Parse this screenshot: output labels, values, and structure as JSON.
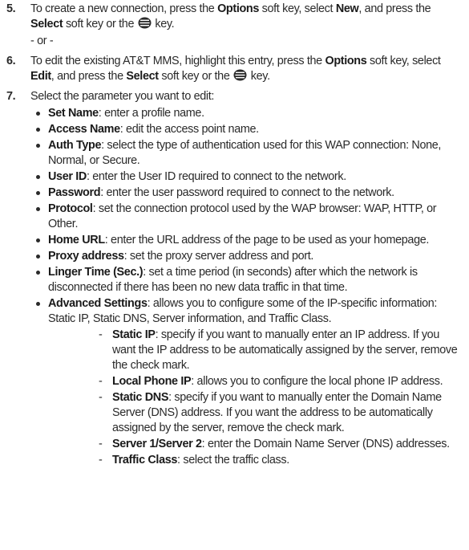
{
  "step5": {
    "number": "5.",
    "t1": "To create a new connection, press the ",
    "b1": "Options",
    "t2": " soft key, select ",
    "b2": "New",
    "t3": ", and press the ",
    "b3": "Select",
    "t4": " soft key or the ",
    "t5": " key."
  },
  "or_text": "- or -",
  "step6": {
    "number": "6.",
    "t1": "To edit the existing AT&T MMS, highlight this entry, press the ",
    "b1": "Options",
    "t2": " soft key, select ",
    "b2": "Edit",
    "t3": ", and press the ",
    "b3": "Select",
    "t4": " soft key or the ",
    "t5": " key."
  },
  "step7": {
    "number": "7.",
    "text": "Select the parameter you want to edit:"
  },
  "params": [
    {
      "name": "Set Name",
      "desc": ": enter a profile name."
    },
    {
      "name": "Access Name",
      "desc": ": edit the access point name."
    },
    {
      "name": "Auth Type",
      "desc": ": select the type of authentication used for this WAP connection: None, Normal, or Secure."
    },
    {
      "name": "User ID",
      "desc": ": enter the User ID required to connect to the network."
    },
    {
      "name": "Password",
      "desc": ": enter the user password required to connect to the network."
    },
    {
      "name": "Protocol",
      "desc": ": set the connection protocol used by the WAP browser: WAP, HTTP, or Other."
    },
    {
      "name": "Home URL",
      "desc": ": enter the URL address of the page to be used as your homepage."
    },
    {
      "name": "Proxy address",
      "desc": ": set the proxy server address and port."
    },
    {
      "name": "Linger Time (Sec.)",
      "desc": ": set a time period (in seconds) after which the network is disconnected if there has been no new data traffic in that time."
    },
    {
      "name": "Advanced Settings",
      "desc": ": allows you to configure some of the IP-specific information: Static IP, Static DNS, Server information, and Traffic Class."
    }
  ],
  "sub_params": [
    {
      "dash": "-",
      "name": "Static IP",
      "desc": ": specify if you want to manually enter an IP address. If you want the IP address to be automatically assigned by the server, remove the check mark."
    },
    {
      "dash": "-",
      "name": "Local Phone IP",
      "desc": ": allows you to configure the local phone IP address."
    },
    {
      "dash": "-",
      "name": "Static DNS",
      "desc": ": specify if you want to manually enter the Domain Name Server (DNS) address. If you want the address to be automatically assigned by the server, remove the check mark."
    },
    {
      "dash": "-",
      "name": "Server 1/Server 2",
      "desc": ": enter the Domain Name Server (DNS) addresses."
    },
    {
      "dash": "-",
      "name": "Traffic Class",
      "desc": ": select the traffic class."
    }
  ]
}
